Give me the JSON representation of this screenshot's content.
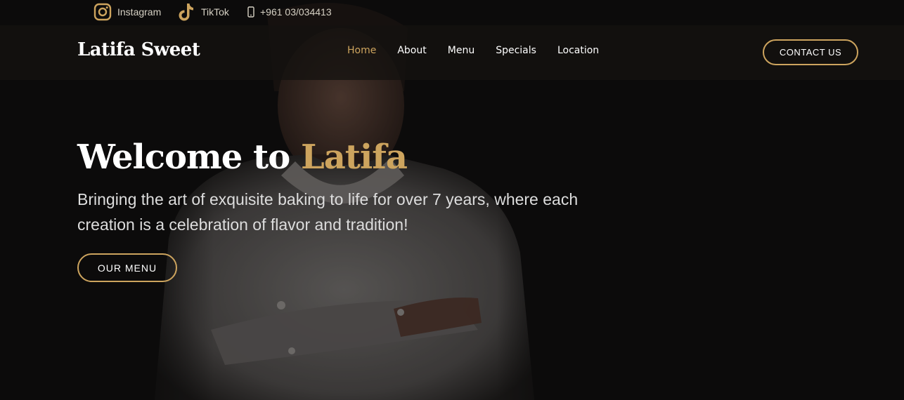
{
  "topbar": {
    "instagram_label": "Instagram",
    "tiktok_label": "TikTok",
    "phone_label": "+961 03/034413"
  },
  "nav": {
    "logo": "Latifa Sweet",
    "links": [
      {
        "label": "Home",
        "active": true
      },
      {
        "label": "About"
      },
      {
        "label": "Menu"
      },
      {
        "label": "Specials"
      },
      {
        "label": "Location"
      }
    ],
    "contact_label": "CONTACT US"
  },
  "hero": {
    "title_prefix": "Welcome to ",
    "title_accent": "Latifa",
    "subtitle": "Bringing the art of exquisite baking to life for over 7 years, where each creation is a celebration of flavor and tradition!",
    "menu_button": "OUR MENU"
  },
  "colors": {
    "accent": "#cda45e",
    "background": "#0c0b0b",
    "navbar": "#141210"
  },
  "icons": {
    "instagram": "instagram-icon",
    "tiktok": "tiktok-icon",
    "phone": "phone-icon"
  }
}
